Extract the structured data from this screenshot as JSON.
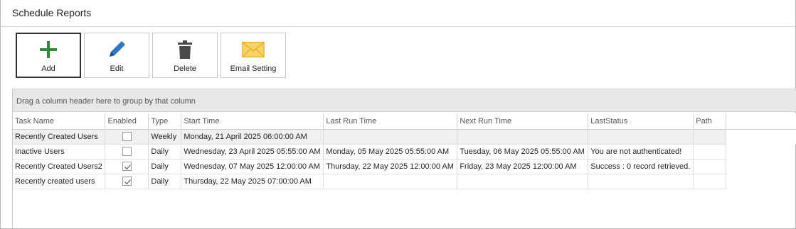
{
  "window": {
    "title": "Schedule Reports"
  },
  "toolbar": {
    "add_label": "Add",
    "edit_label": "Edit",
    "delete_label": "Delete",
    "email_label": "Email Setting"
  },
  "grid": {
    "group_hint": "Drag a column header here to group by that column",
    "columns": [
      "Task Name",
      "Enabled",
      "Type",
      "Start Time",
      "Last Run Time",
      "Next Run Time",
      "LastStatus",
      "Path"
    ],
    "rows": [
      {
        "task_name": "Recently Created Users",
        "enabled": false,
        "type": "Weekly",
        "start_time": "Monday, 21 April 2025 06:00:00 AM",
        "last_run": "",
        "next_run": "",
        "last_status": "",
        "path": ""
      },
      {
        "task_name": "Inactive Users",
        "enabled": false,
        "type": "Daily",
        "start_time": "Wednesday, 23 April 2025 05:55:00 AM",
        "last_run": "Monday, 05 May 2025 05:55:00 AM",
        "next_run": "Tuesday, 06 May 2025 05:55:00 AM",
        "last_status": "You are not authenticated!",
        "path": ""
      },
      {
        "task_name": "Recently Created Users2",
        "enabled": true,
        "type": "Daily",
        "start_time": "Wednesday, 07 May 2025 12:00:00 AM",
        "last_run": "Thursday, 22 May 2025 12:00:00 AM",
        "next_run": "Friday, 23 May 2025 12:00:00 AM",
        "last_status": "Success : 0 record retrieved.",
        "path": ""
      },
      {
        "task_name": "Recently created users",
        "enabled": true,
        "type": "Daily",
        "start_time": "Thursday, 22 May 2025 07:00:00 AM",
        "last_run": "",
        "next_run": "",
        "last_status": "",
        "path": ""
      }
    ]
  },
  "colors": {
    "add_green": "#2e8b3a",
    "edit_blue": "#2f74c9",
    "delete_gray": "#4a4a4a",
    "email_yellow": "#f2c53d"
  },
  "icons": {
    "add": "plus-icon",
    "edit": "pencil-icon",
    "delete": "trash-icon",
    "email": "envelope-icon"
  }
}
